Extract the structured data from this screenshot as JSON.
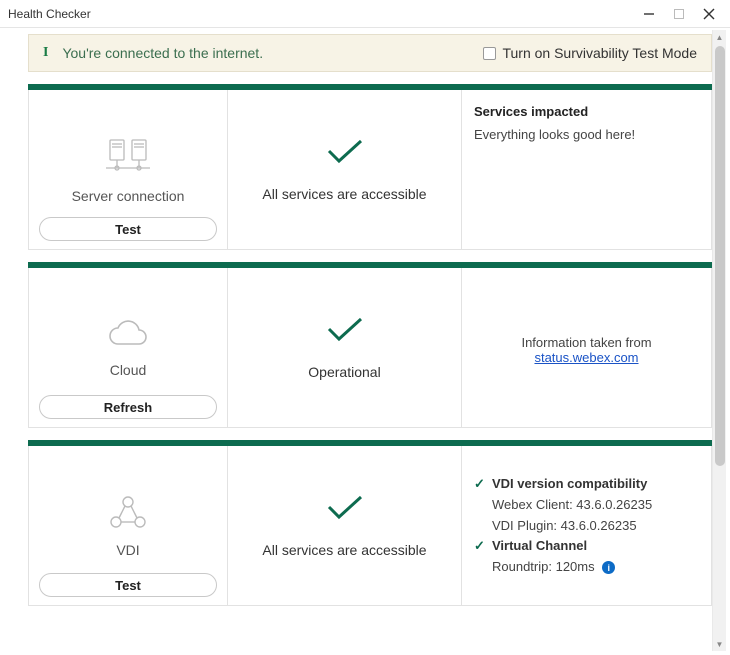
{
  "window": {
    "title": "Health Checker"
  },
  "status_bar": {
    "message": "You're connected to the internet.",
    "toggle_label": "Turn on Survivability Test Mode"
  },
  "panels": {
    "server": {
      "title": "Server connection",
      "status_text": "All services are accessible",
      "action_label": "Test",
      "info_heading": "Services impacted",
      "info_body": "Everything looks good here!"
    },
    "cloud": {
      "title": "Cloud",
      "status_text": "Operational",
      "action_label": "Refresh",
      "info_heading": "Information taken from",
      "info_link": "status.webex.com"
    },
    "vdi": {
      "title": "VDI",
      "status_text": "All services are accessible",
      "action_label": "Test",
      "compat_heading": "VDI version compatibility",
      "webex_client": "Webex Client: 43.6.0.26235",
      "vdi_plugin": "VDI Plugin: 43.6.0.26235",
      "channel_heading": "Virtual Channel",
      "roundtrip": "Roundtrip: 120ms"
    }
  }
}
